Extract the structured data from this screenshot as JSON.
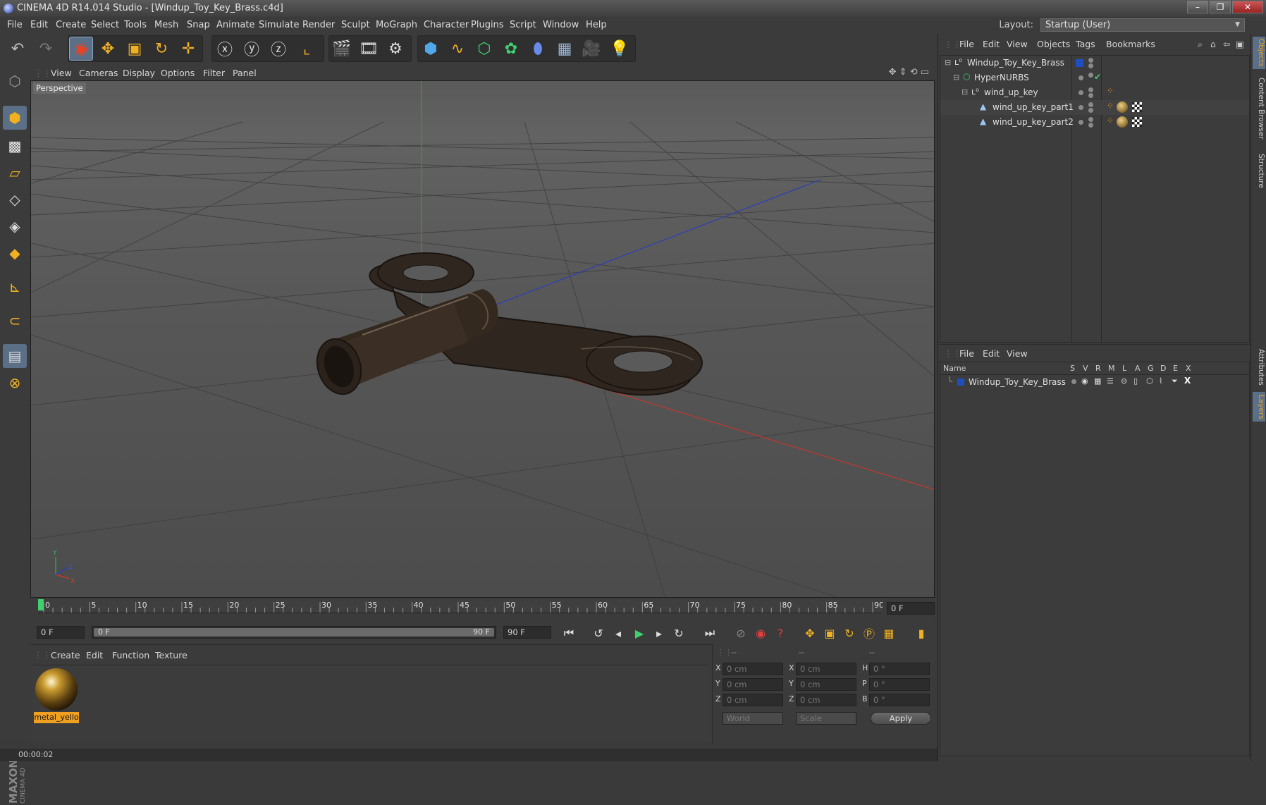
{
  "window": {
    "title": "CINEMA 4D R14.014 Studio - [Windup_Toy_Key_Brass.c4d]",
    "buttons": [
      "–",
      "❐",
      "✕"
    ]
  },
  "menu": [
    "File",
    "Edit",
    "Create",
    "Select",
    "Tools",
    "Mesh",
    "Snap",
    "Animate",
    "Simulate",
    "Render",
    "Sculpt",
    "MoGraph",
    "Character",
    "Plugins",
    "Script",
    "Window",
    "Help"
  ],
  "layout": {
    "label": "Layout:",
    "value": "Startup (User)"
  },
  "viewport": {
    "menu": [
      "View",
      "Cameras",
      "Display",
      "Options",
      "Filter",
      "Panel"
    ],
    "label": "Perspective"
  },
  "timeline": {
    "ticks": [
      "0",
      "5",
      "10",
      "15",
      "20",
      "25",
      "30",
      "35",
      "40",
      "45",
      "50",
      "55",
      "60",
      "65",
      "70",
      "75",
      "80",
      "85",
      "90"
    ],
    "current_field": "0 F",
    "start_field": "0 F",
    "range_start": "0 F",
    "range_end": "90 F",
    "end_field": "90 F"
  },
  "materials": {
    "menu": [
      "Create",
      "Edit",
      "Function",
      "Texture"
    ],
    "items": [
      {
        "name": "metal_yello"
      }
    ]
  },
  "coordinates": {
    "header": [
      "--",
      "--",
      "--"
    ],
    "rows": [
      {
        "a": "X",
        "av": "0 cm",
        "b": "X",
        "bv": "0 cm",
        "c": "H",
        "cv": "0 °"
      },
      {
        "a": "Y",
        "av": "0 cm",
        "b": "Y",
        "bv": "0 cm",
        "c": "P",
        "cv": "0 °"
      },
      {
        "a": "Z",
        "av": "0 cm",
        "b": "Z",
        "bv": "0 cm",
        "c": "B",
        "cv": "0 °"
      }
    ],
    "mode1": "World",
    "mode2": "Scale",
    "apply": "Apply"
  },
  "status": {
    "time": "00:00:02"
  },
  "objects": {
    "menu": [
      "File",
      "Edit",
      "View",
      "Objects",
      "Tags",
      "Bookmarks"
    ],
    "tree": [
      {
        "name": "Windup_Toy_Key_Brass"
      },
      {
        "name": "HyperNURBS"
      },
      {
        "name": "wind_up_key"
      },
      {
        "name": "wind_up_key_part1"
      },
      {
        "name": "wind_up_key_part2"
      }
    ]
  },
  "layers": {
    "menu": [
      "File",
      "Edit",
      "View"
    ],
    "columns": [
      "Name",
      "S",
      "V",
      "R",
      "M",
      "L",
      "A",
      "G",
      "D",
      "E",
      "X"
    ],
    "rows": [
      {
        "name": "Windup_Toy_Key_Brass"
      }
    ]
  },
  "side_tabs": [
    "Objects",
    "Content Browser",
    "Structure",
    "Attributes",
    "Layers"
  ],
  "colors": {
    "accent": "#5b6f86",
    "layer_color": "#1e4fc0",
    "axis_x": "#c0392b",
    "axis_y": "#2ea043",
    "axis_z": "#2b3fb8"
  }
}
